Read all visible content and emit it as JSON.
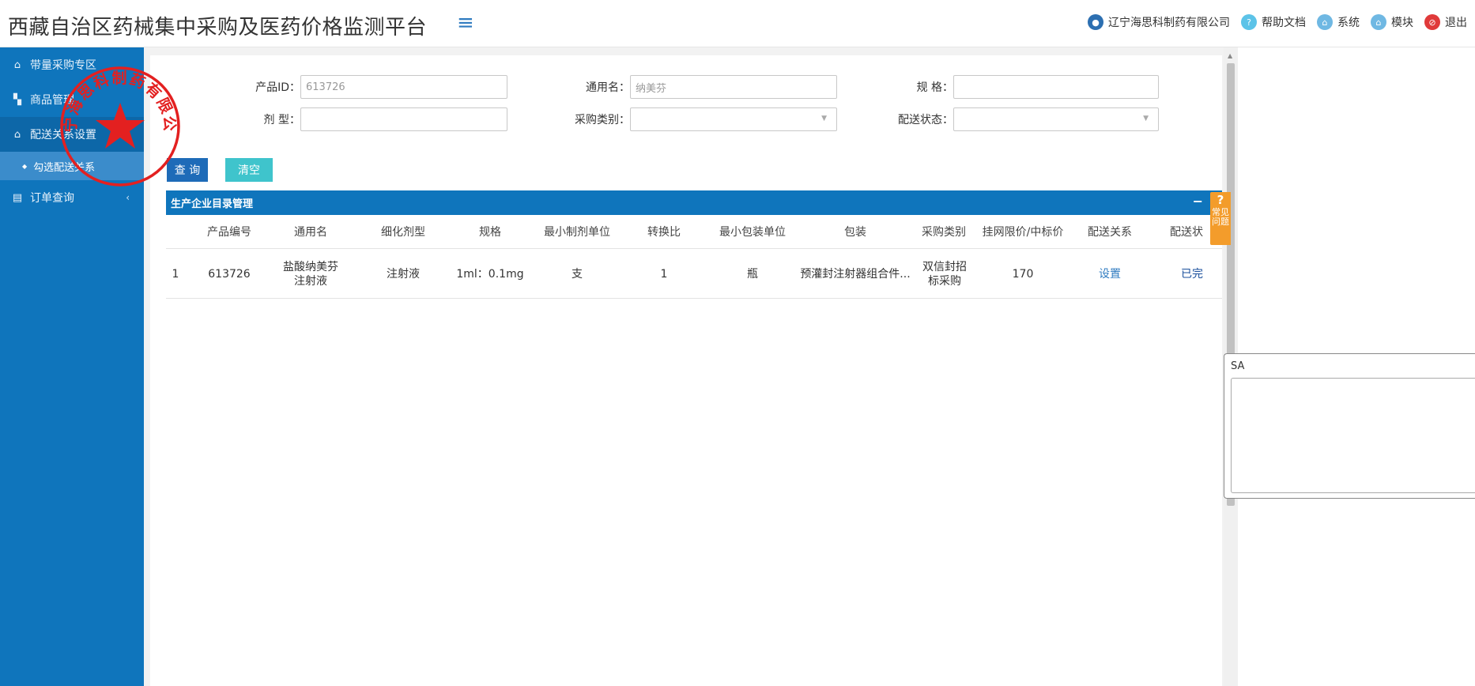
{
  "header": {
    "title": "西藏自治区药械集中采购及医药价格监测平台",
    "menu_icon": "hamburger-icon",
    "user": "辽宁海思科制药有限公司",
    "help": "帮助文档",
    "system": "系统",
    "module": "模块",
    "logout": "退出"
  },
  "sidebar": {
    "items": [
      {
        "label": "带量采购专区",
        "icon": "home-icon"
      },
      {
        "label": "商品管理",
        "icon": "box-icon"
      },
      {
        "label": "配送关系设置",
        "icon": "home-icon",
        "arrow": "⌄"
      },
      {
        "label": "订单查询",
        "icon": "document-icon",
        "arrow": "‹"
      }
    ],
    "sub_item": "勾选配送关系"
  },
  "seal_text": "辽宁海思科制药有限公司",
  "filters": {
    "product_id_label": "产品ID：",
    "product_id_value": "613726",
    "generic_name_label": "通用名：",
    "generic_name_value": "纳美芬",
    "spec_label": "规 格：",
    "spec_value": "",
    "dosage_label": "剂 型：",
    "dosage_value": "",
    "purchase_type_label": "采购类别：",
    "purchase_type_value": "",
    "delivery_status_label": "配送状态：",
    "delivery_status_value": ""
  },
  "buttons": {
    "query": "查 询",
    "clear": "清空"
  },
  "panel": {
    "title": "生产企业目录管理",
    "minimize": "−"
  },
  "table": {
    "columns": [
      "产品编号",
      "通用名",
      "细化剂型",
      "规格",
      "最小制剂单位",
      "转换比",
      "最小包装单位",
      "包装",
      "采购类别",
      "挂网限价/中标价",
      "配送关系",
      "配送状"
    ],
    "rows": [
      {
        "index": "1",
        "product_no": "613726",
        "generic_name": "盐酸纳美芬注射液",
        "dosage_form": "注射液",
        "spec": "1ml：0.1mg",
        "min_unit": "支",
        "ratio": "1",
        "min_pack_unit": "瓶",
        "packaging": "预灌封注射器组合件...",
        "purchase_type": "双信封招标采购",
        "price": "170",
        "delivery_relation": "设置",
        "delivery_status": "已完"
      }
    ]
  },
  "faq": {
    "q": "?",
    "text": "常见问题"
  },
  "side_panel_label": "SA",
  "colors": {
    "sidebar": "#0f75bc",
    "accent": "#1e6bb8",
    "clear": "#3fc4cc",
    "faq": "#f39c2b",
    "logout": "#e03a3a"
  }
}
